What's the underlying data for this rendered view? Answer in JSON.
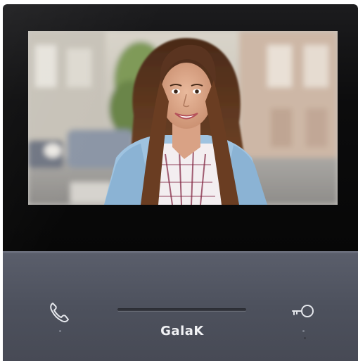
{
  "device": {
    "brand_label": "GalaK"
  },
  "icons": {
    "call": "phone-handset-icon",
    "unlock": "key-icon"
  },
  "colors": {
    "panel": "#50545f",
    "glass": "#0c0c0d",
    "brand_text": "#f1f2f5"
  }
}
